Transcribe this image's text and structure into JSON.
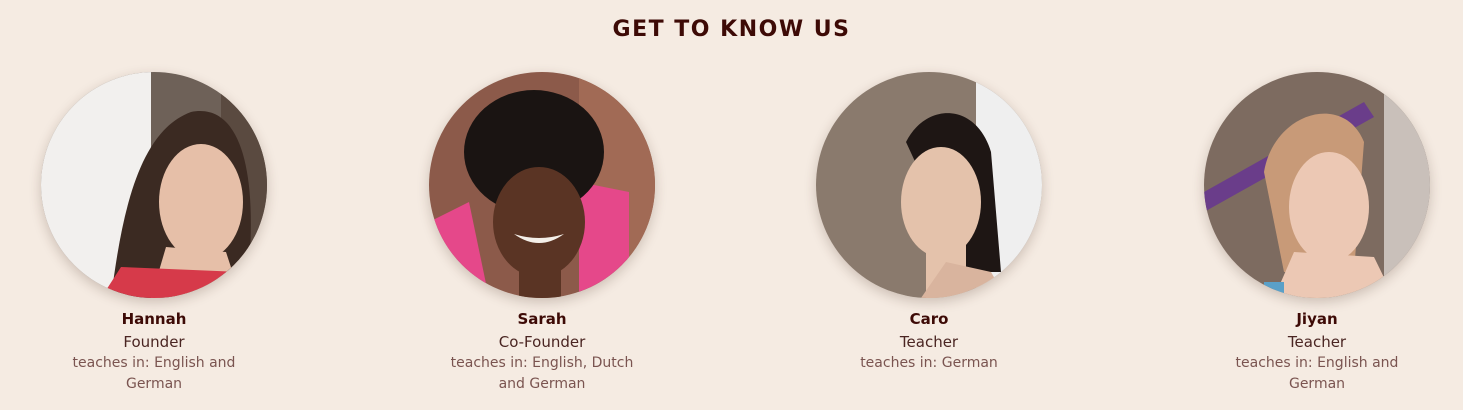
{
  "section": {
    "title": "GET TO KNOW US"
  },
  "team": [
    {
      "name": "Hannah",
      "role": "Founder",
      "languages": "teaches in: English and German"
    },
    {
      "name": "Sarah",
      "role": "Co-Founder",
      "languages": "teaches in: English, Dutch and German"
    },
    {
      "name": "Caro",
      "role": "Teacher",
      "languages": "teaches in: German"
    },
    {
      "name": "Jiyan",
      "role": "Teacher",
      "languages": "teaches in: English and German"
    }
  ],
  "colors": {
    "background": "#f5ebe2",
    "heading": "#3d0a06",
    "text": "#4a2522",
    "muted": "#7a5450"
  }
}
